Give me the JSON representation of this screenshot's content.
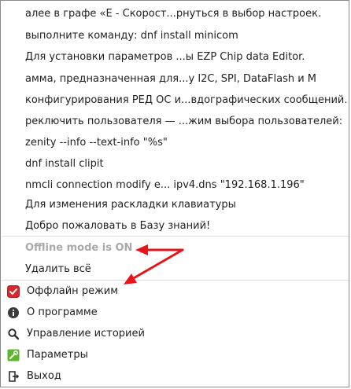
{
  "history": [
    "алее в графе «Е - Скорост...рнуться в выбор настроек.",
    "выполните команду:  dnf install minicom",
    "Для установки параметров ...ы EZP Chip data Editor.",
    "амма, предназначенная для...у I2C, SPI, DataFlash и M",
    "конфигурирования РЕД ОС и...вдографических сообщений.",
    "реключить пользователя — ...жим выбора пользователей:",
    "zenity --info --text-info \"%s\"",
    "dnf install clipit",
    "nmcli connection modify e... ipv4.dns \"192.168.1.196\"",
    "Для изменения раскладки клавиатуры",
    "Добро пожаловать в Базу знаний!"
  ],
  "status": "Offline mode is ON",
  "clear_label": "Удалить всё",
  "actions": {
    "offline": "Оффлайн режим",
    "about": "О программе",
    "history": "Управление историей",
    "settings": "Параметры",
    "exit": "Выход"
  },
  "colors": {
    "arrow": "#e8141b",
    "checkbox": "#d9262f",
    "status_text": "#a9a9a9"
  },
  "icons": {
    "offline": "checkbox-checked-icon",
    "about": "info-icon",
    "history": "search-icon",
    "settings": "wrench-icon",
    "exit": "exit-door-icon"
  }
}
